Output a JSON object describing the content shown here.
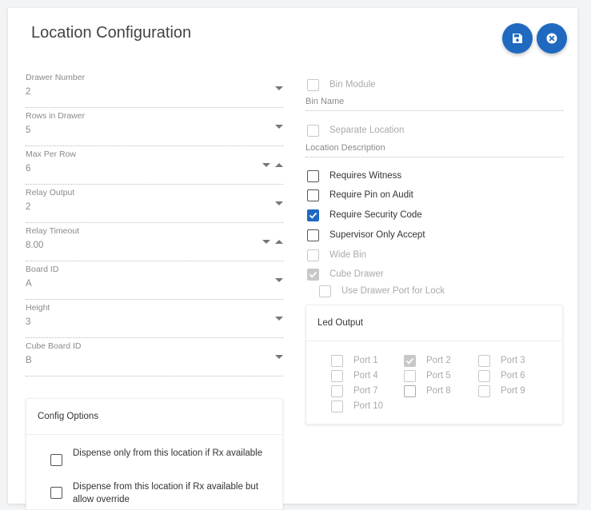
{
  "dialog": {
    "title": "Location Configuration"
  },
  "left_fields": [
    {
      "label": "Drawer Number",
      "value": "2",
      "stepper": false
    },
    {
      "label": "Rows in Drawer",
      "value": "5",
      "stepper": false
    },
    {
      "label": "Max Per Row",
      "value": "6",
      "stepper": true
    },
    {
      "label": "Relay Output",
      "value": "2",
      "stepper": false
    },
    {
      "label": "Relay Timeout",
      "value": "8.00",
      "stepper": true
    },
    {
      "label": "Board ID",
      "value": "A",
      "stepper": false
    },
    {
      "label": "Height",
      "value": "3",
      "stepper": false
    },
    {
      "label": "Cube Board ID",
      "value": "B",
      "stepper": false
    }
  ],
  "right": {
    "bin_module": {
      "label": "Bin Module",
      "checked": false,
      "disabled": true
    },
    "bin_name_placeholder": "Bin Name",
    "separate_location": {
      "label": "Separate Location",
      "checked": false,
      "disabled": true
    },
    "location_description_placeholder": "Location Description",
    "requires_witness": {
      "label": "Requires Witness",
      "checked": false
    },
    "require_pin": {
      "label": "Require Pin on Audit",
      "checked": false
    },
    "require_security": {
      "label": "Require Security Code",
      "checked": true
    },
    "supervisor_only": {
      "label": "Supervisor Only Accept",
      "checked": false
    },
    "wide_bin": {
      "label": "Wide Bin",
      "checked": false,
      "disabled": true
    },
    "cube_drawer": {
      "label": "Cube Drawer",
      "checked": true,
      "disabled": true
    },
    "use_drawer_port": {
      "label": "Use Drawer Port for Lock",
      "checked": false,
      "disabled": true
    }
  },
  "led_output": {
    "title": "Led Output",
    "ports": [
      {
        "label": "Port 1",
        "checked": false
      },
      {
        "label": "Port 2",
        "checked": true
      },
      {
        "label": "Port 3",
        "checked": false
      },
      {
        "label": "Port 4",
        "checked": false
      },
      {
        "label": "Port 5",
        "checked": false
      },
      {
        "label": "Port 6",
        "checked": false
      },
      {
        "label": "Port 7",
        "checked": false
      },
      {
        "label": "Port 8",
        "checked": false
      },
      {
        "label": "Port 9",
        "checked": false
      },
      {
        "label": "Port 10",
        "checked": false
      }
    ]
  },
  "config_options": {
    "title": "Config Options",
    "options": [
      {
        "label": "Dispense only from this location if Rx available",
        "checked": false
      },
      {
        "label": "Dispense from this location if Rx available but allow override",
        "checked": false
      }
    ]
  },
  "colors": {
    "accent": "#1f69c0",
    "muted": "#8a8a8a",
    "disabled": "#c8c8c8"
  },
  "icons": {
    "save": "floppy-disk-icon",
    "close": "close-circle-icon"
  }
}
